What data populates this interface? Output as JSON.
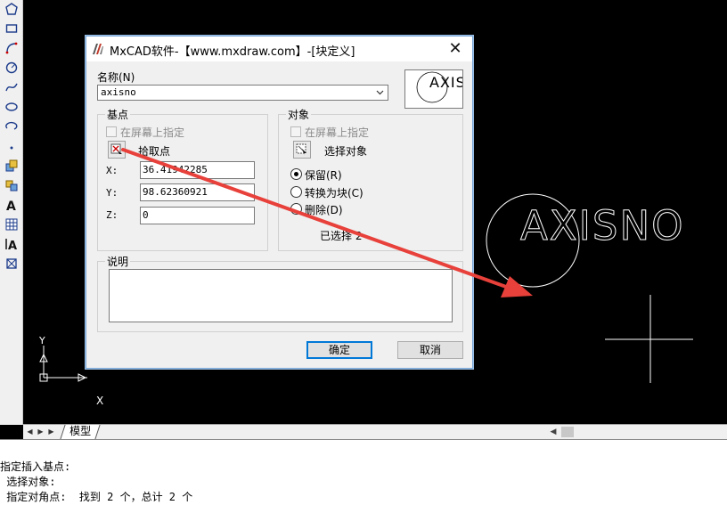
{
  "window": {
    "title": "MxCAD软件-【www.mxdraw.com】-[块定义]"
  },
  "dialog": {
    "name_label": "名称(N)",
    "name_value": "axisno",
    "preview_text": "AXIS",
    "base_point": {
      "title": "基点",
      "on_screen_label": "在屏幕上指定",
      "pick_label": "拾取点",
      "x_label": "X:",
      "x_value": "36.41942285",
      "y_label": "Y:",
      "y_value": "98.62360921",
      "z_label": "Z:",
      "z_value": "0"
    },
    "objects": {
      "title": "对象",
      "on_screen_label": "在屏幕上指定",
      "select_label": "选择对象",
      "retain_label": "保留(R)",
      "convert_label": "转换为块(C)",
      "delete_label": "删除(D)",
      "selected_text": "已选择 2",
      "selected_option": "retain"
    },
    "description": {
      "title": "说明",
      "value": ""
    },
    "ok_label": "确定",
    "cancel_label": "取消"
  },
  "canvas": {
    "block_text": "AXISNO",
    "axis_x_label": "X",
    "axis_y_label": "Y"
  },
  "tabbar": {
    "model_tab": "模型"
  },
  "command_line": {
    "lines": [
      "指定插入基点:",
      " 选择对象:",
      " 指定对角点:  找到 2 个，总计 2 个"
    ]
  },
  "colors": {
    "arrow": "#e8403a",
    "accent": "#0078d7",
    "canvas": "#000000",
    "cad_lines": "#ffffff"
  }
}
